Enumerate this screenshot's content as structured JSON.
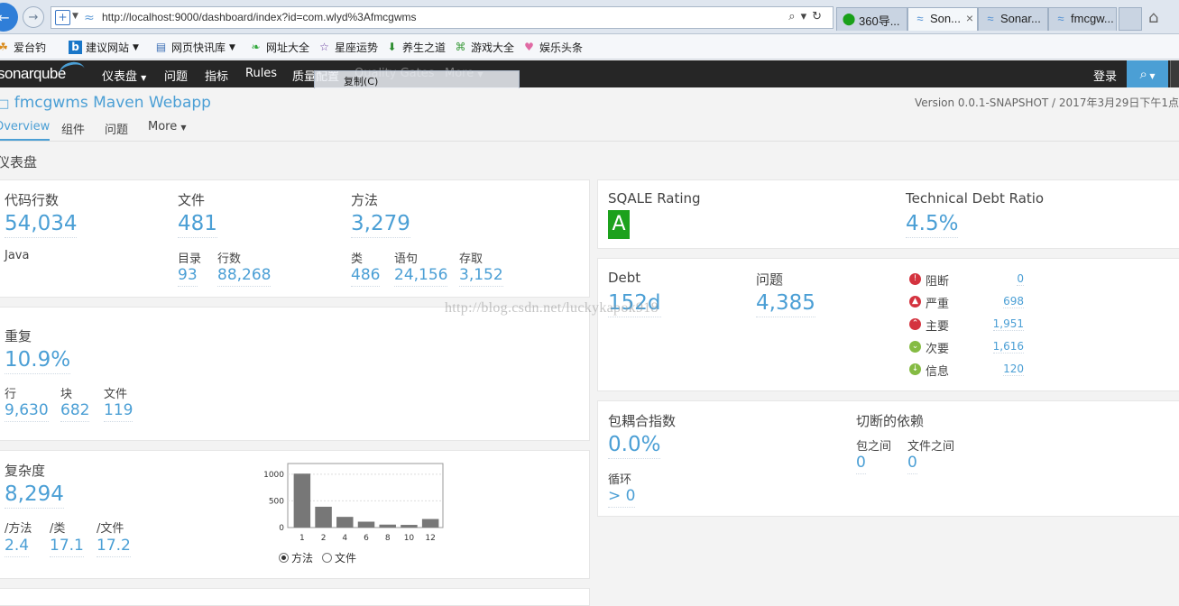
{
  "browser": {
    "url": "http://localhost:9000/dashboard/index?id=com.wlyd%3Afmcgwms",
    "tabs": [
      {
        "label": "360导..."
      },
      {
        "label": "Son..."
      },
      {
        "label": "Sonar..."
      },
      {
        "label": "fmcgw..."
      }
    ],
    "bookmarks": [
      {
        "label": "爱台钓"
      },
      {
        "label": "建议网站"
      },
      {
        "label": "网页快讯库"
      },
      {
        "label": "网址大全"
      },
      {
        "label": "星座运势"
      },
      {
        "label": "养生之道"
      },
      {
        "label": "游戏大全"
      },
      {
        "label": "娱乐头条"
      }
    ]
  },
  "sonar_nav": {
    "logo": "sonarqube",
    "items": [
      "仪表盘",
      "问题",
      "指标",
      "Rules",
      "质量配置",
      "Quality Gates",
      "More"
    ],
    "login": "登录",
    "context_menu_item": "复制(C)"
  },
  "project": {
    "title": "fmcgwms Maven Webapp",
    "version": "Version 0.0.1-SNAPSHOT / 2017年3月29日下午1点",
    "tabs": [
      "Overview",
      "组件",
      "问题",
      "More"
    ]
  },
  "dashboard_title": "仪表盘",
  "size_widget": {
    "loc_label": "代码行数",
    "loc_value": "54,034",
    "language": "Java",
    "files_label": "文件",
    "files_value": "481",
    "dirs_label": "目录",
    "dirs_value": "93",
    "lines_label": "行数",
    "lines_value": "88,268",
    "functions_label": "方法",
    "functions_value": "3,279",
    "classes_label": "类",
    "classes_value": "486",
    "statements_label": "语句",
    "statements_value": "24,156",
    "accessors_label": "存取",
    "accessors_value": "3,152"
  },
  "duplication_widget": {
    "label": "重复",
    "value": "10.9%",
    "lines_label": "行",
    "lines_value": "9,630",
    "blocks_label": "块",
    "blocks_value": "682",
    "files_label": "文件",
    "files_value": "119"
  },
  "complexity_widget": {
    "label": "复杂度",
    "value": "8,294",
    "per_method_label": "/方法",
    "per_method_value": "2.4",
    "per_class_label": "/类",
    "per_class_value": "17.1",
    "per_file_label": "/文件",
    "per_file_value": "17.2",
    "radio_method": "方法",
    "radio_file": "文件"
  },
  "sqale_widget": {
    "rating_label": "SQALE Rating",
    "rating_value": "A",
    "debt_ratio_label": "Technical Debt Ratio",
    "debt_ratio_value": "4.5%"
  },
  "issues_widget": {
    "debt_label": "Debt",
    "debt_value": "152d",
    "issues_label": "问题",
    "issues_value": "4,385",
    "severities": [
      {
        "label": "阻断",
        "value": "0",
        "color": "#d4333f",
        "icon": "blocker-icon"
      },
      {
        "label": "严重",
        "value": "698",
        "color": "#d4333f",
        "icon": "critical-icon"
      },
      {
        "label": "主要",
        "value": "1,951",
        "color": "#d4333f",
        "icon": "major-icon"
      },
      {
        "label": "次要",
        "value": "1,616",
        "color": "#85bb43",
        "icon": "minor-icon"
      },
      {
        "label": "信息",
        "value": "120",
        "color": "#85bb43",
        "icon": "info-icon"
      }
    ]
  },
  "design_widget": {
    "tangle_label": "包耦合指数",
    "tangle_value": "0.0%",
    "cycles_label": "循环",
    "cycles_value": "> 0",
    "dependencies_label": "切断的依赖",
    "between_packages_label": "包之间",
    "between_packages_value": "0",
    "between_files_label": "文件之间",
    "between_files_value": "0"
  },
  "watermark": "http://blog.csdn.net/luckykapok918",
  "chart_data": {
    "type": "bar",
    "categories": [
      "1",
      "2",
      "4",
      "6",
      "8",
      "10",
      "12"
    ],
    "values": [
      1010,
      390,
      200,
      110,
      55,
      50,
      160
    ],
    "ylim": [
      0,
      1200
    ],
    "yticks": [
      0,
      500,
      1000
    ],
    "grid": true,
    "bar_color": "#777777"
  }
}
